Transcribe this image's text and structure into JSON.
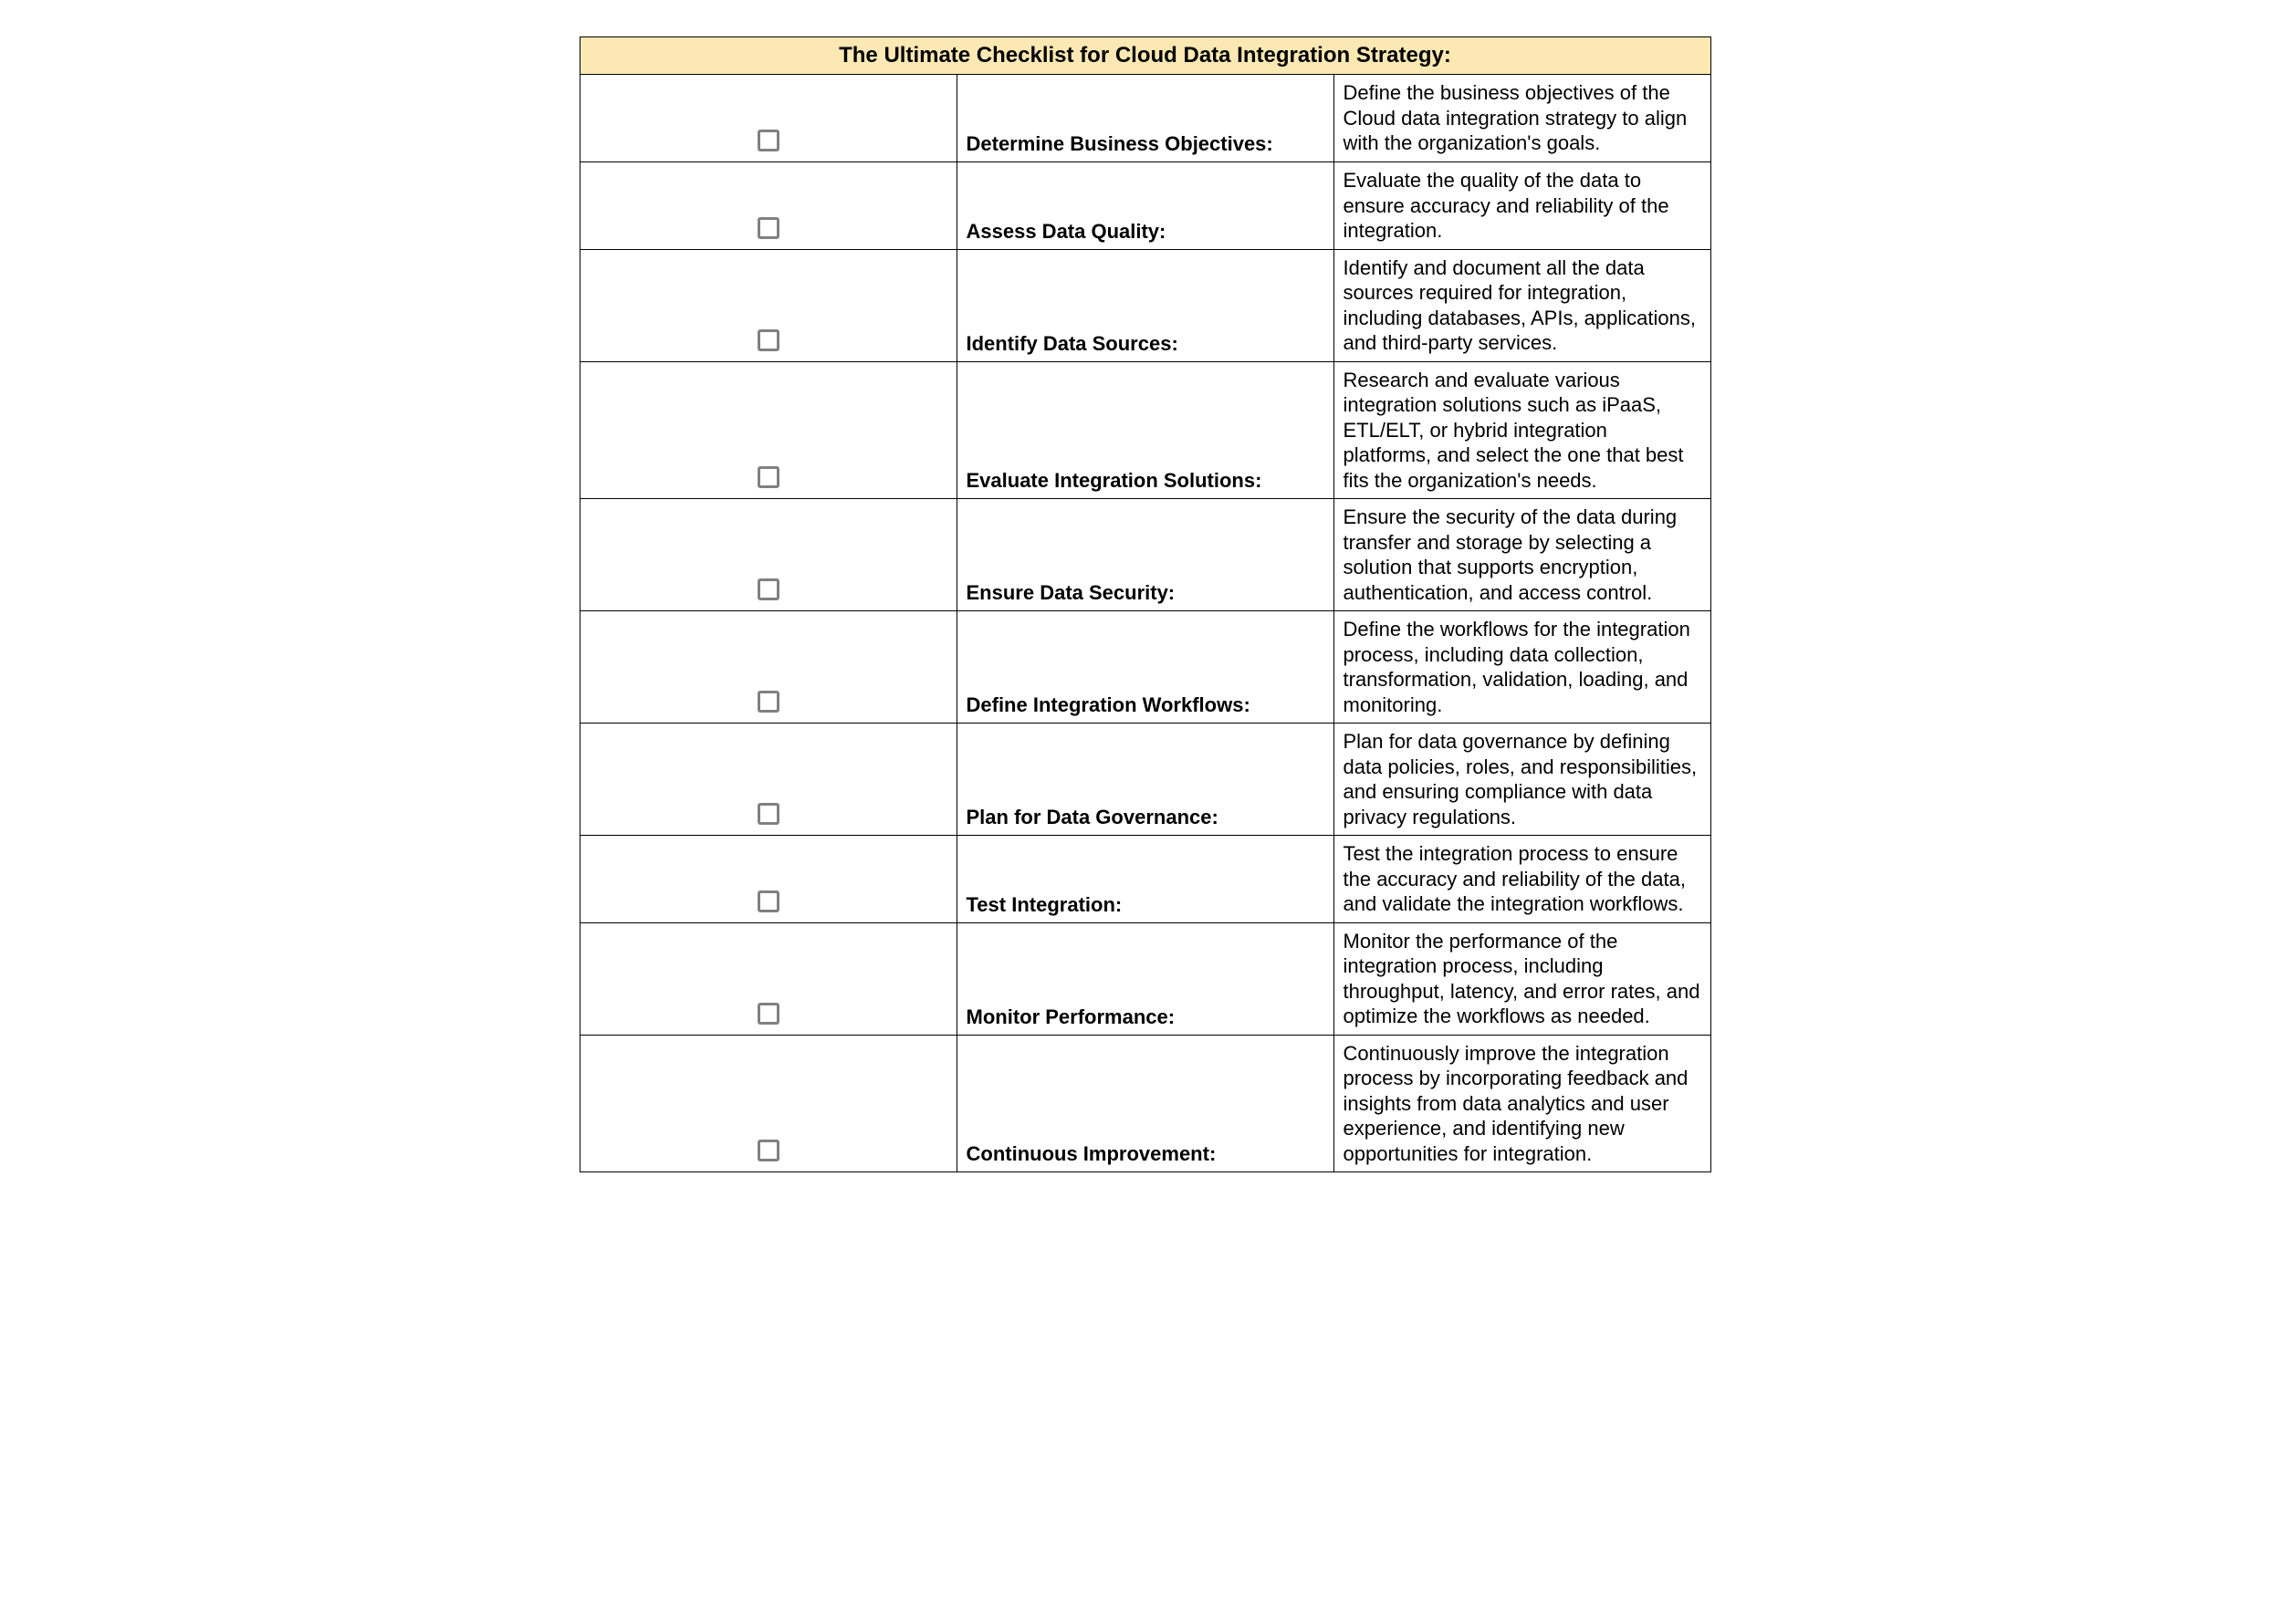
{
  "header": {
    "title": "The Ultimate Checklist for Cloud Data Integration Strategy:"
  },
  "rows": [
    {
      "title": "Determine Business Objectives:",
      "description": "Define the business objectives of the Cloud data integration strategy to align with the organization's goals."
    },
    {
      "title": "Assess Data Quality:",
      "description": "Evaluate the quality of the data to ensure accuracy and reliability of the integration."
    },
    {
      "title": "Identify Data Sources:",
      "description": "Identify and document all the data sources required for integration, including databases, APIs, applications, and third-party services."
    },
    {
      "title": "Evaluate Integration Solutions:",
      "description": "Research and evaluate various integration solutions such as iPaaS, ETL/ELT, or hybrid integration platforms, and select the one that best fits the organization's needs."
    },
    {
      "title": "Ensure Data Security:",
      "description": "Ensure the security of the data during transfer and storage by selecting a solution that supports encryption, authentication, and access control."
    },
    {
      "title": "Define Integration Workflows:",
      "description": "Define the workflows for the integration process, including data collection, transformation, validation, loading, and monitoring."
    },
    {
      "title": "Plan for Data Governance:",
      "description": "Plan for data governance by defining data policies, roles, and responsibilities, and ensuring compliance with data privacy regulations."
    },
    {
      "title": "Test Integration:",
      "description": "Test the integration process to ensure the accuracy and reliability of the data, and validate the integration workflows."
    },
    {
      "title": "Monitor Performance:",
      "description": "Monitor the performance of the integration process, including throughput, latency, and error rates, and optimize the workflows as needed."
    },
    {
      "title": "Continuous Improvement:",
      "description": "Continuously improve the integration process by incorporating feedback and insights from data analytics and user experience, and identifying new opportunities for integration."
    }
  ]
}
